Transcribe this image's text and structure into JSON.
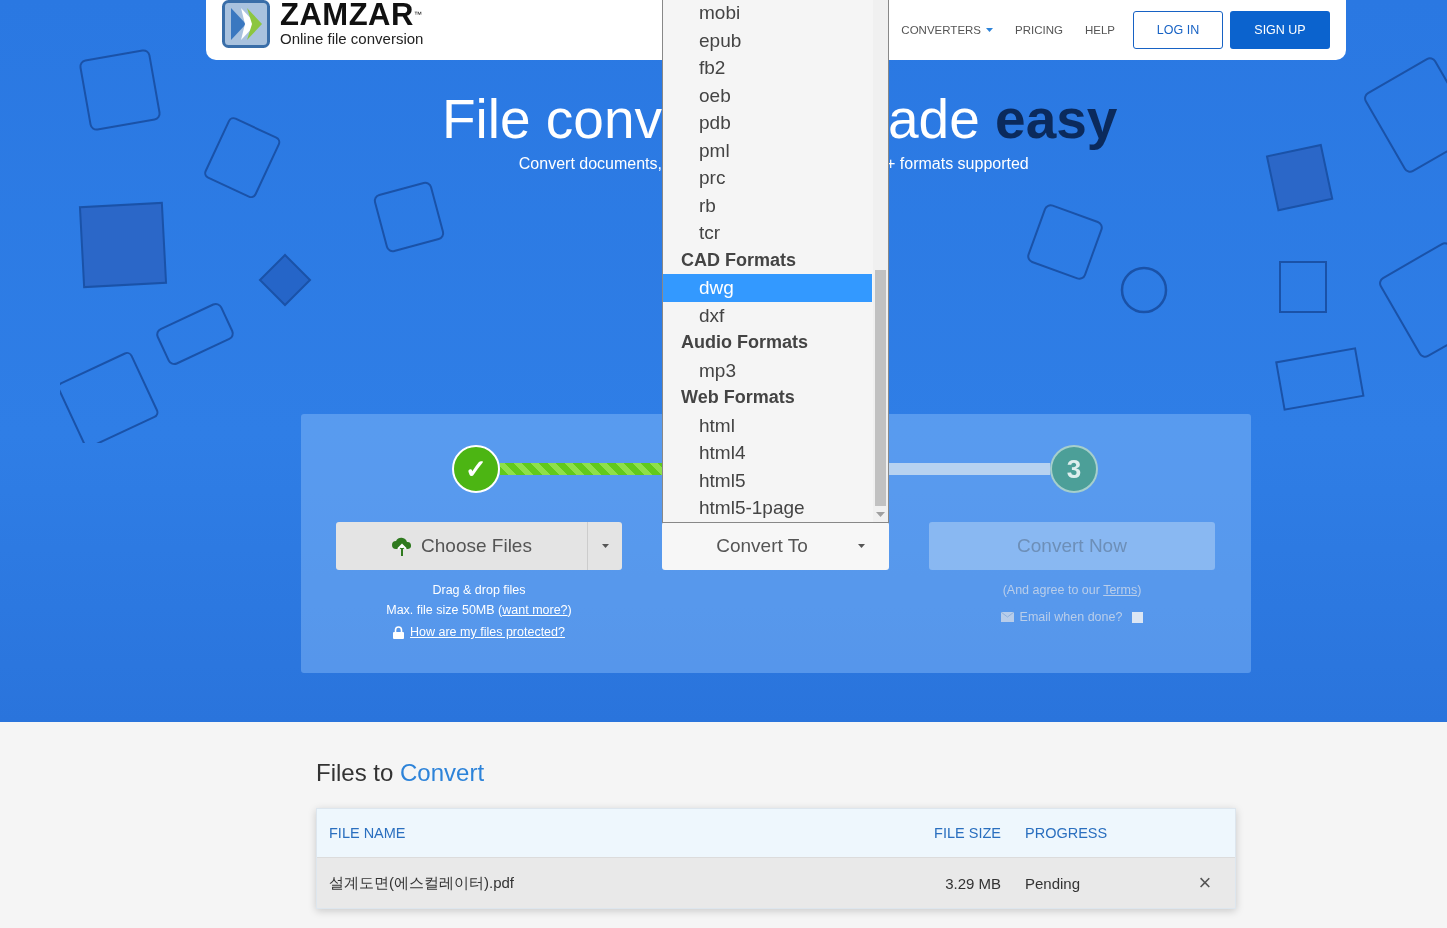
{
  "header": {
    "logo": {
      "name": "ZAMZAR",
      "trademark": "™",
      "tagline": "Online file conversion"
    },
    "nav": [
      {
        "label": "CONVERTERS",
        "kind": "dropdown"
      },
      {
        "label": "PRICING",
        "kind": "link"
      },
      {
        "label": "HELP",
        "kind": "link"
      }
    ],
    "buttons": [
      {
        "label": "LOG IN",
        "kind": "outline"
      },
      {
        "label": "SIGN UP",
        "kind": "primary"
      }
    ]
  },
  "hero": {
    "title_left": "File conv",
    "title_right": "ade",
    "title_emphasis": "easy",
    "subtitle_left": "Convert documents,",
    "subtitle_right": "+ formats supported"
  },
  "steps": [
    {
      "label": "✓",
      "done": true
    },
    {
      "label": "3",
      "done": false
    }
  ],
  "choose_files": {
    "label": "Choose Files",
    "notes": [
      {
        "kind": "text",
        "text": "Drag & drop files"
      },
      {
        "kind": "text_link",
        "text": "Max. file size 50MB (",
        "link": "want more?",
        "after": ")"
      },
      {
        "kind": "lock_link",
        "link": "How are my files protected?"
      }
    ]
  },
  "convert_to": {
    "label": "Convert To",
    "menu": [
      {
        "kind": "option",
        "label": "mobi",
        "selected": false
      },
      {
        "kind": "option",
        "label": "epub",
        "selected": false
      },
      {
        "kind": "option",
        "label": "fb2",
        "selected": false
      },
      {
        "kind": "option",
        "label": "oeb",
        "selected": false
      },
      {
        "kind": "option",
        "label": "pdb",
        "selected": false
      },
      {
        "kind": "option",
        "label": "pml",
        "selected": false
      },
      {
        "kind": "option",
        "label": "prc",
        "selected": false
      },
      {
        "kind": "option",
        "label": "rb",
        "selected": false
      },
      {
        "kind": "option",
        "label": "tcr",
        "selected": false
      },
      {
        "kind": "group",
        "label": "CAD Formats"
      },
      {
        "kind": "option",
        "label": "dwg",
        "selected": true
      },
      {
        "kind": "option",
        "label": "dxf",
        "selected": false
      },
      {
        "kind": "group",
        "label": "Audio Formats"
      },
      {
        "kind": "option",
        "label": "mp3",
        "selected": false
      },
      {
        "kind": "group",
        "label": "Web Formats"
      },
      {
        "kind": "option",
        "label": "html",
        "selected": false
      },
      {
        "kind": "option",
        "label": "html4",
        "selected": false
      },
      {
        "kind": "option",
        "label": "html5",
        "selected": false
      },
      {
        "kind": "option",
        "label": "html5-1page",
        "selected": false
      }
    ]
  },
  "convert_now": {
    "label": "Convert Now",
    "disabled": true,
    "terms_before": "(And agree to our ",
    "terms_link": "Terms",
    "terms_after": ")",
    "email_label": "Email when done?",
    "email_checked": false
  },
  "files": {
    "title": "Files to",
    "title_accent": "Convert",
    "columns": [
      "FILE NAME",
      "FILE SIZE",
      "PROGRESS"
    ],
    "rows": [
      {
        "name": "설계도면(에스컬레이터).pdf",
        "size": "3.29 MB",
        "progress": "Pending",
        "remove": "×"
      }
    ]
  }
}
